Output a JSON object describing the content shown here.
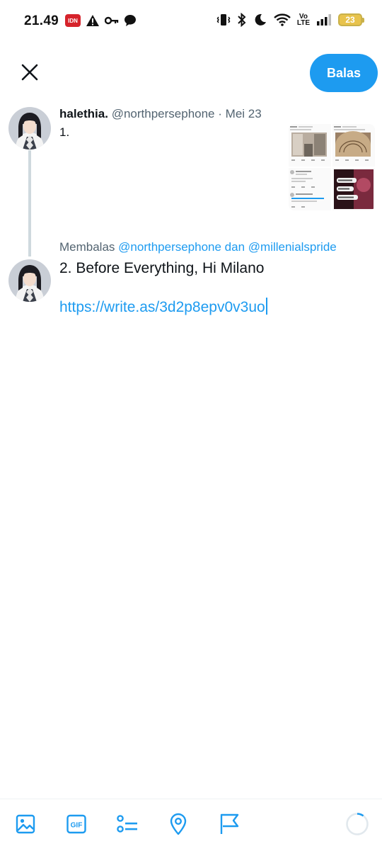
{
  "status_bar": {
    "time": "21.49",
    "idn_badge": "IDN",
    "volte_top": "Vo",
    "volte_bottom": "LTE",
    "battery": "23"
  },
  "header": {
    "reply_button_label": "Balas"
  },
  "original_tweet": {
    "display_name": "halethia.",
    "handle": "@northpersephone",
    "separator": "·",
    "date": "Mei 23",
    "text": "1.",
    "media_count": 4
  },
  "compose": {
    "replying_prefix": "Membalas",
    "replying_handles": "@northpersephone dan @millenialspride",
    "line1": "2. Before Everything, Hi Milano",
    "link": "https://write.as/3d2p8epv0v3uo"
  },
  "toolbar": {
    "icons": [
      "image-icon",
      "gif-icon",
      "poll-icon",
      "location-icon",
      "flag-icon"
    ],
    "gif_label": "GIF",
    "char_progress": 0.1
  },
  "colors": {
    "accent": "#1d9bf0",
    "muted": "#536471",
    "text": "#0f1419",
    "thread_line": "#cfd9de"
  }
}
